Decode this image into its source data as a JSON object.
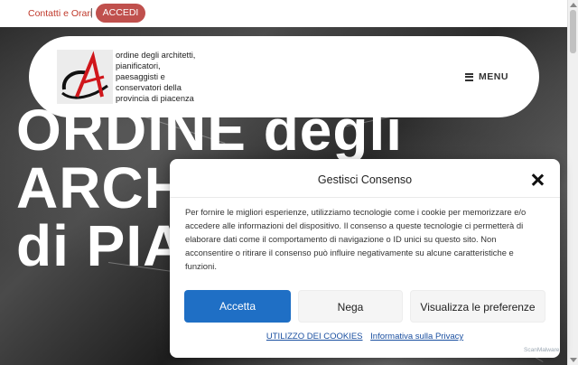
{
  "topbar": {
    "contact_link": "Contatti e Orari",
    "separator": "|",
    "login_button": "ACCEDI"
  },
  "header": {
    "org_name_lines": [
      "ordine degli architetti,",
      "pianificatori,",
      "paesaggisti e",
      "conservatori della",
      "provincia di piacenza"
    ],
    "menu_label": "MENU"
  },
  "hero": {
    "title_lines": [
      "ORDINE degli",
      "ARCHITETTI",
      "di PIACENZA"
    ]
  },
  "consent": {
    "title": "Gestisci Consenso",
    "body": "Per fornire le migliori esperienze, utilizziamo tecnologie come i cookie per memorizzare e/o accedere alle informazioni del dispositivo. Il consenso a queste tecnologie ci permetterà di elaborare dati come il comportamento di navigazione o ID unici su questo sito. Non acconsentire o ritirare il consenso può influire negativamente su alcune caratteristiche e funzioni.",
    "accept_label": "Accetta",
    "deny_label": "Nega",
    "prefs_label": "Visualizza le preferenze",
    "cookies_link": "UTILIZZO DEI COOKIES",
    "privacy_link": "Informativa sulla Privacy"
  },
  "badge": "ScanMalware",
  "colors": {
    "accent_red": "#c0504d",
    "primary_blue": "#1f6fc5"
  }
}
